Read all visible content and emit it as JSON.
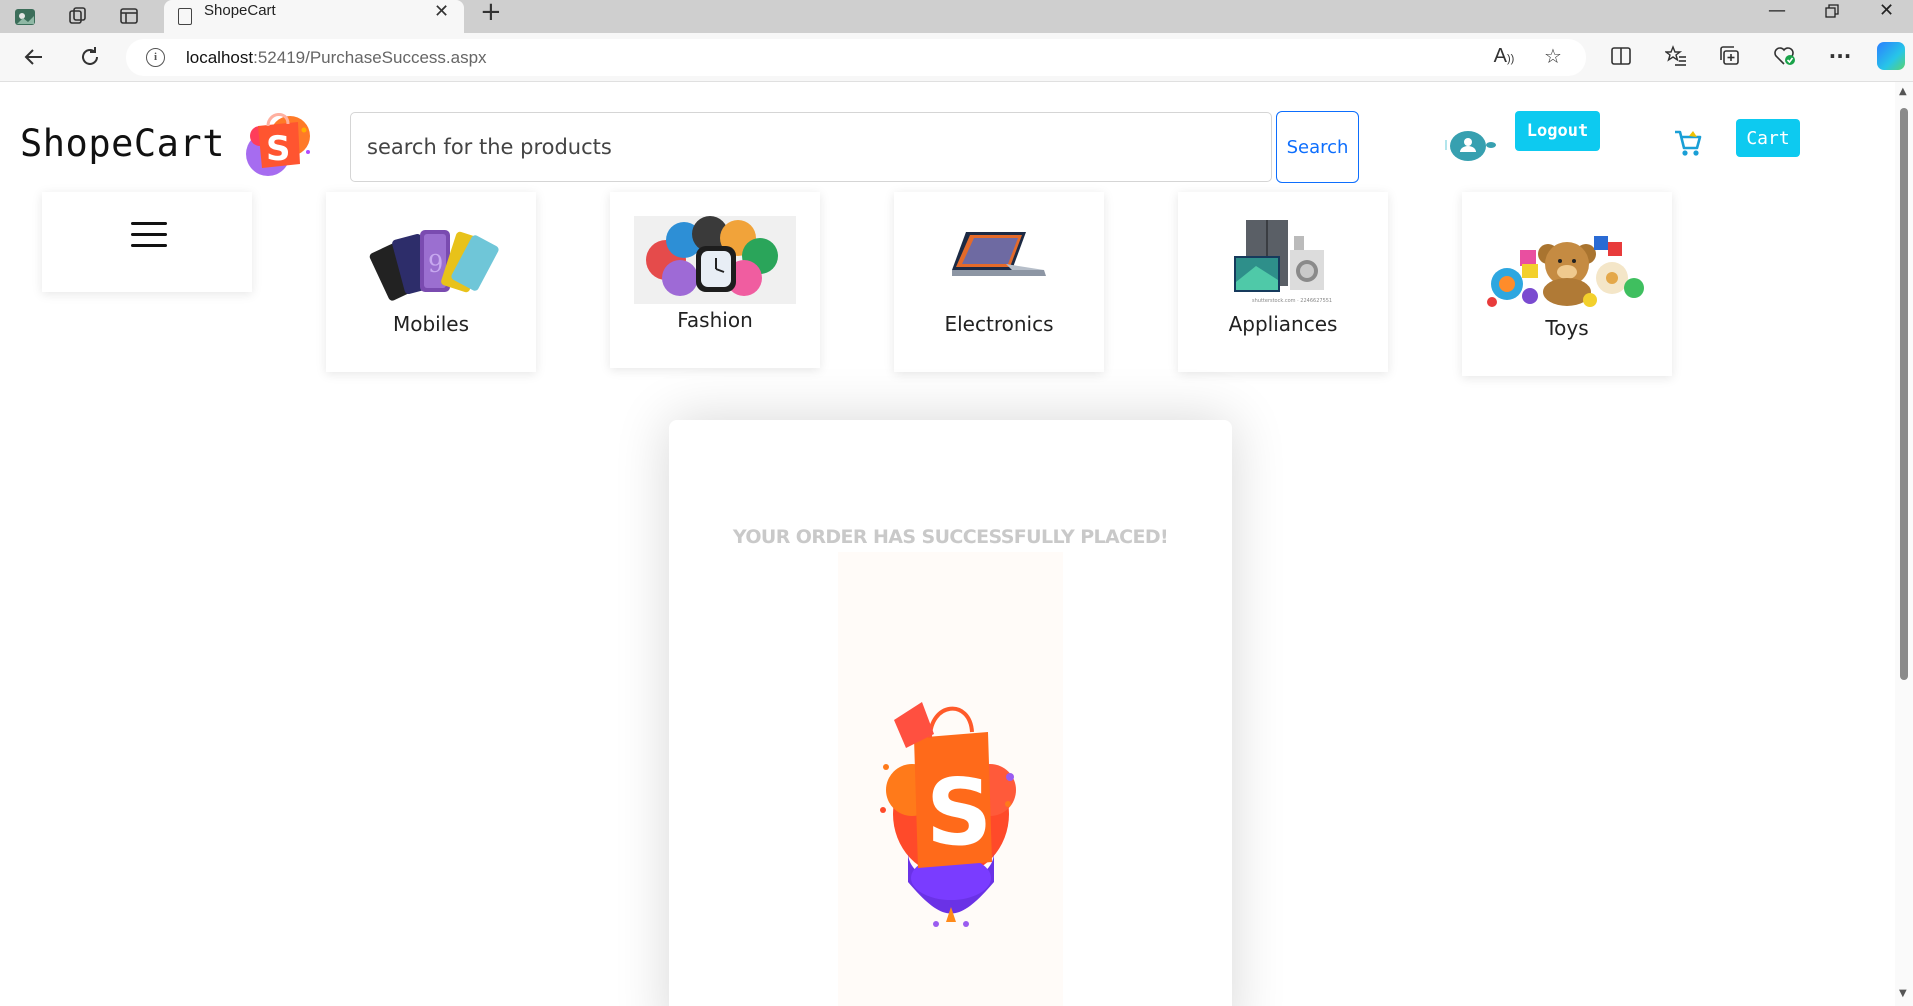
{
  "browser": {
    "tab_title": "ShopeCart",
    "url_host": "localhost",
    "url_path": ":52419/PurchaseSuccess.aspx"
  },
  "header": {
    "brand": "ShopeCart",
    "search_placeholder": "search for the products",
    "search_button": "Search",
    "logout_button": "Logout",
    "cart_button": "Cart"
  },
  "categories": [
    {
      "label": "Mobiles",
      "icon": "mobiles-image"
    },
    {
      "label": "Fashion",
      "icon": "fashion-image"
    },
    {
      "label": "Electronics",
      "icon": "electronics-image"
    },
    {
      "label": "Appliances",
      "icon": "appliances-image"
    },
    {
      "label": "Toys",
      "icon": "toys-image"
    }
  ],
  "success": {
    "message": "YOUR ORDER HAS SUCCESSFULLY PLACED!",
    "image": "shopecart-bag-logo"
  },
  "colors": {
    "accent": "#0dcaf0",
    "search_border": "#0d6efd"
  }
}
